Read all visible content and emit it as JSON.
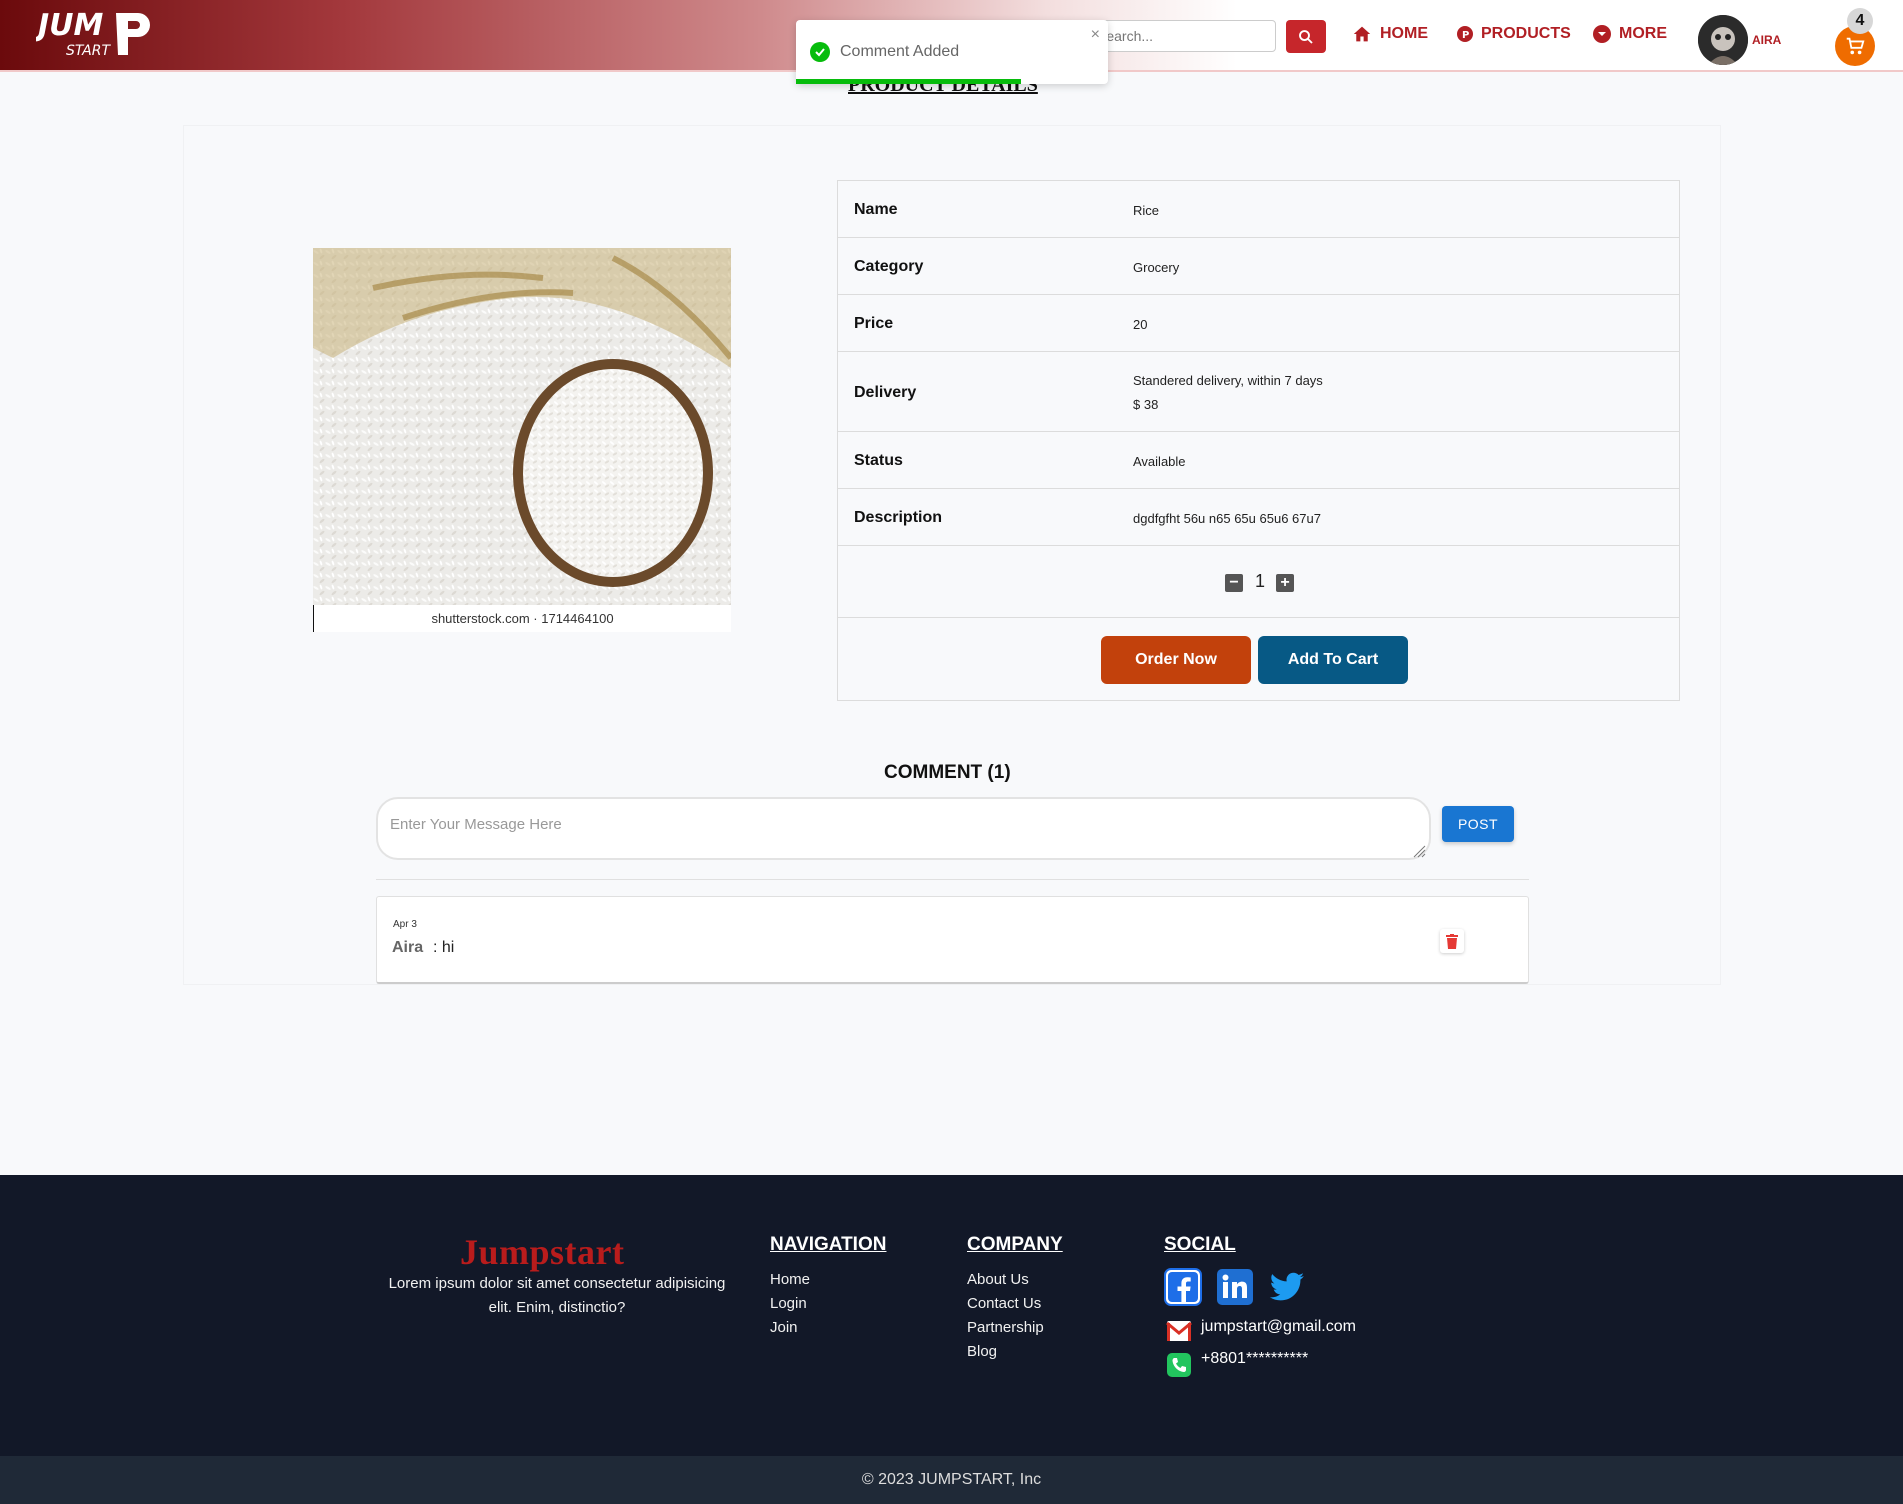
{
  "header": {
    "logo_text_top": "JUMP",
    "logo_text_bottom": "START",
    "search_placeholder": "Search...",
    "nav": {
      "home": "HOME",
      "products": "PRODUCTS",
      "more": "MORE"
    },
    "user_name": "AIRA",
    "cart_count": "4"
  },
  "toast": {
    "message": "Comment Added",
    "close": "×",
    "progress_fraction": 0.72
  },
  "page_title": "PRODUCT DETAILS",
  "product": {
    "image_caption": "shutterstock.com · 1714464100",
    "rows": [
      {
        "key": "Name",
        "value": "Rice"
      },
      {
        "key": "Category",
        "value": "Grocery"
      },
      {
        "key": "Price",
        "value": "20"
      },
      {
        "key": "Delivery",
        "value": "Standered delivery, within 7 days",
        "value2": "$ 38"
      },
      {
        "key": "Status",
        "value": "Available"
      },
      {
        "key": "Description",
        "value": "dgdfgfht 56u n65 65u 65u6 67u7"
      }
    ],
    "quantity": "1",
    "order_label": "Order Now",
    "cart_label": "Add To Cart"
  },
  "comments": {
    "title": "COMMENT (1)",
    "placeholder": "Enter Your Message Here",
    "post_label": "POST",
    "items": [
      {
        "date": "Apr 3",
        "author": "Aira",
        "text": ": hi"
      }
    ]
  },
  "footer": {
    "brand": "Jumpstart",
    "description": "Lorem ipsum dolor sit amet consectetur adipisicing elit. Enim, distinctio?",
    "navigation": {
      "title": "NAVIGATION",
      "links": [
        "Home",
        "Login",
        "Join"
      ]
    },
    "company": {
      "title": "COMPANY",
      "links": [
        "About Us",
        "Contact Us",
        "Partnership",
        "Blog"
      ]
    },
    "social": {
      "title": "SOCIAL",
      "email": "jumpstart@gmail.com",
      "phone": "+8801**********"
    },
    "copyright": "© 2023 JUMPSTART, Inc"
  },
  "colors": {
    "brand_red": "#b11f24",
    "order_btn": "#c2410c",
    "cart_btn": "#075985",
    "post_btn": "#1976d2",
    "footer_bg": "#121828"
  }
}
